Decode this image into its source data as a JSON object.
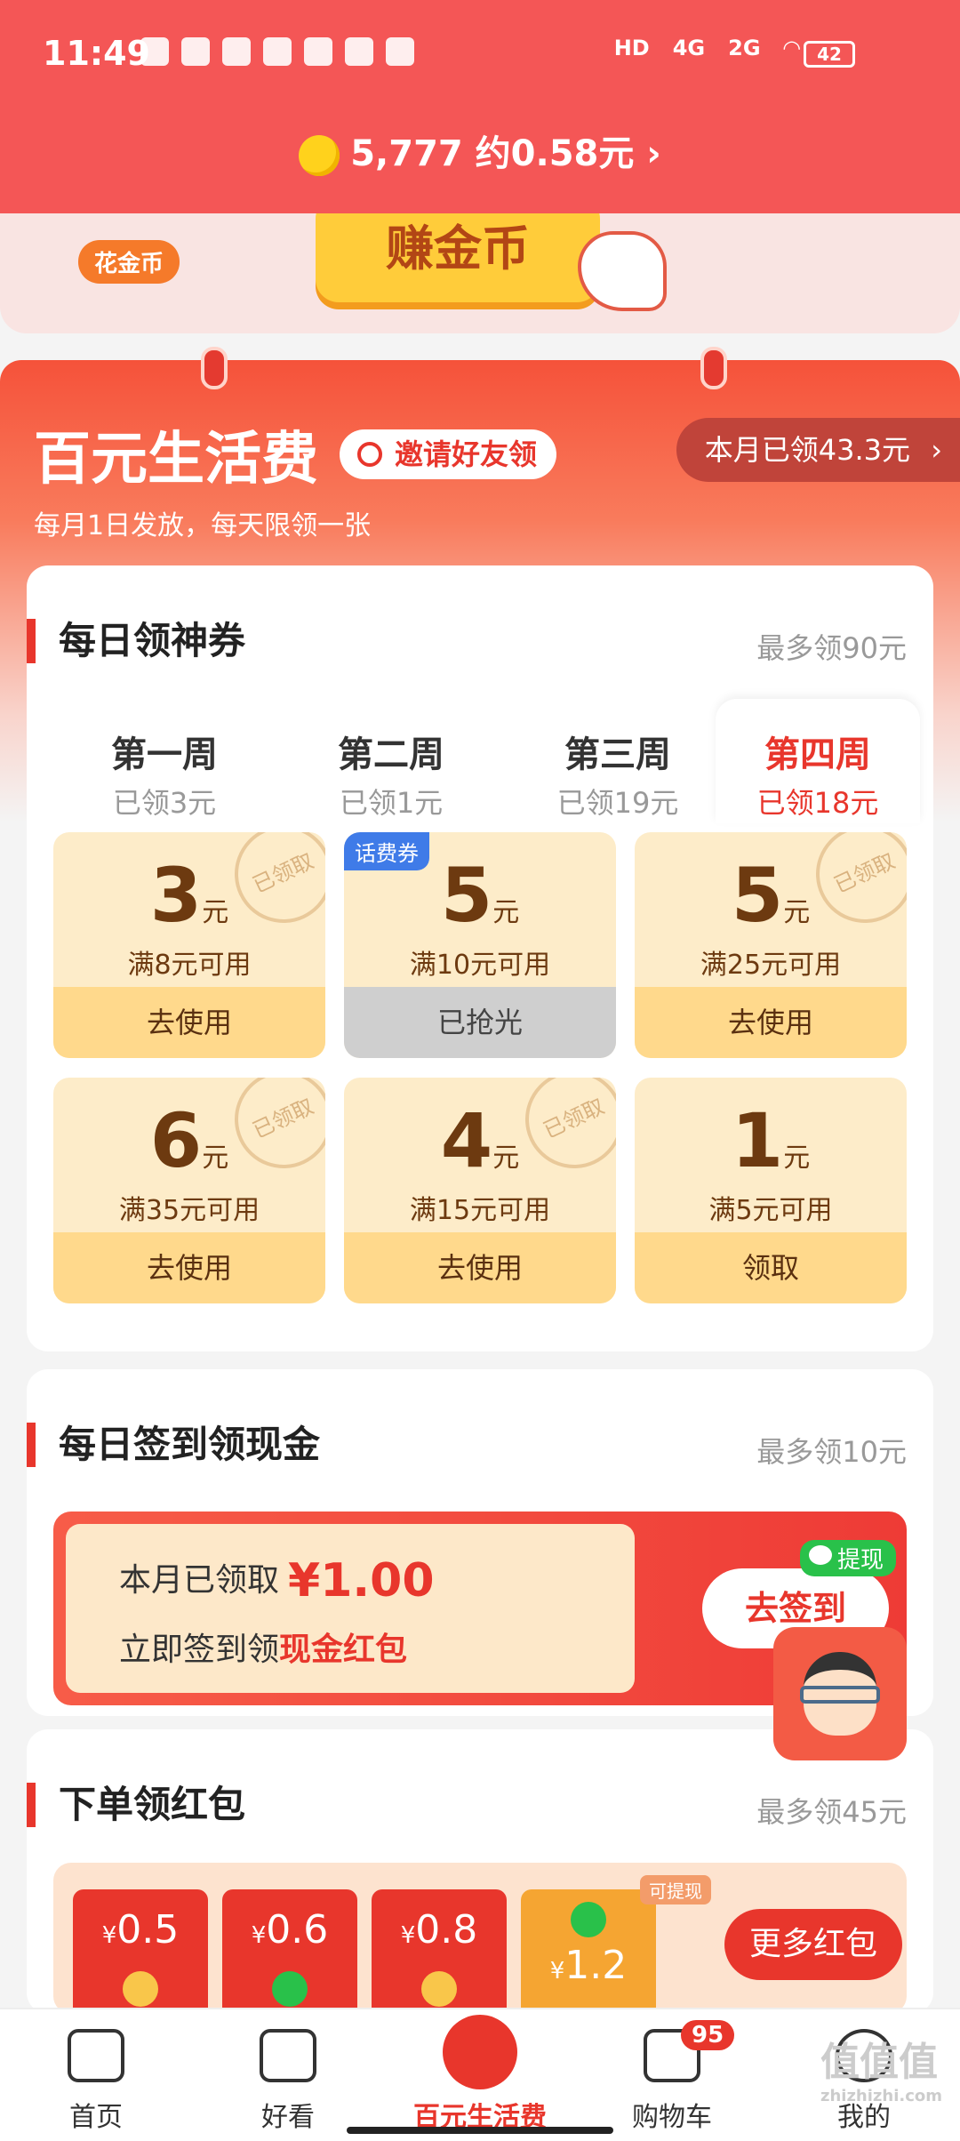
{
  "status_bar": {
    "time": "11:49",
    "hd": "HD",
    "net1": "4G",
    "net2": "2G",
    "battery": "42"
  },
  "coins": {
    "text": "5,777 约0.58元 ›"
  },
  "banner": {
    "tag": "花金币",
    "button": "赚金币"
  },
  "panel": {
    "title": "百元生活费",
    "invite": "邀请好友领",
    "month_received": "本月已领43.3元",
    "subtitle": "每月1日发放，每天限领一张"
  },
  "daily_coupons": {
    "title": "每日领神券",
    "note": "最多领90元",
    "weeks": [
      {
        "name": "第一周",
        "got": "已领3元"
      },
      {
        "name": "第二周",
        "got": "已领1元"
      },
      {
        "name": "第三周",
        "got": "已领19元"
      },
      {
        "name": "第四周",
        "got": "已领18元"
      }
    ],
    "items": [
      {
        "amount": "3",
        "unit": "元",
        "cond": "满8元可用",
        "action": "去使用",
        "stamp": "已领取"
      },
      {
        "amount": "5",
        "unit": "元",
        "cond": "满10元可用",
        "action": "已抢光",
        "tag": "话费券"
      },
      {
        "amount": "5",
        "unit": "元",
        "cond": "满25元可用",
        "action": "去使用",
        "stamp": "已领取"
      },
      {
        "amount": "6",
        "unit": "元",
        "cond": "满35元可用",
        "action": "去使用",
        "stamp": "已领取"
      },
      {
        "amount": "4",
        "unit": "元",
        "cond": "满15元可用",
        "action": "去使用",
        "stamp": "已领取"
      },
      {
        "amount": "1",
        "unit": "元",
        "cond": "满5元可用",
        "action": "领取"
      }
    ]
  },
  "signin": {
    "title": "每日签到领现金",
    "note": "最多领10元",
    "received_label": "本月已领取",
    "received_value": "¥1.00",
    "line2_a": "立即签到领",
    "line2_b": "现金红包",
    "button": "去签到",
    "cash_tag": "提现"
  },
  "packets": {
    "title": "下单领红包",
    "note": "最多领45元",
    "values": [
      "0.5",
      "0.6",
      "0.8",
      "1.2"
    ],
    "currency": "¥",
    "withdraw_tag": "可提现",
    "more": "更多红包"
  },
  "nav": [
    {
      "label": "首页"
    },
    {
      "label": "好看"
    },
    {
      "label": "百元生活费"
    },
    {
      "label": "购物车",
      "badge": "95"
    },
    {
      "label": "我的"
    }
  ],
  "watermark": {
    "main": "值值值",
    "sub": "zhizhizhi.com"
  }
}
